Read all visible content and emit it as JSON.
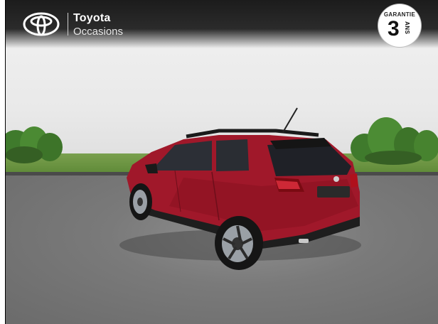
{
  "header": {
    "brand": "Toyota",
    "subbrand": "Occasions",
    "logo_icon": "toyota-emblem-icon"
  },
  "warranty_badge": {
    "top_text": "GARANTIE",
    "number": "3",
    "unit": "ANS"
  },
  "colors": {
    "header_bg": "#1c1c1c",
    "car_body": "#a0182a",
    "grass": "#6a9640",
    "asphalt": "#777777"
  }
}
